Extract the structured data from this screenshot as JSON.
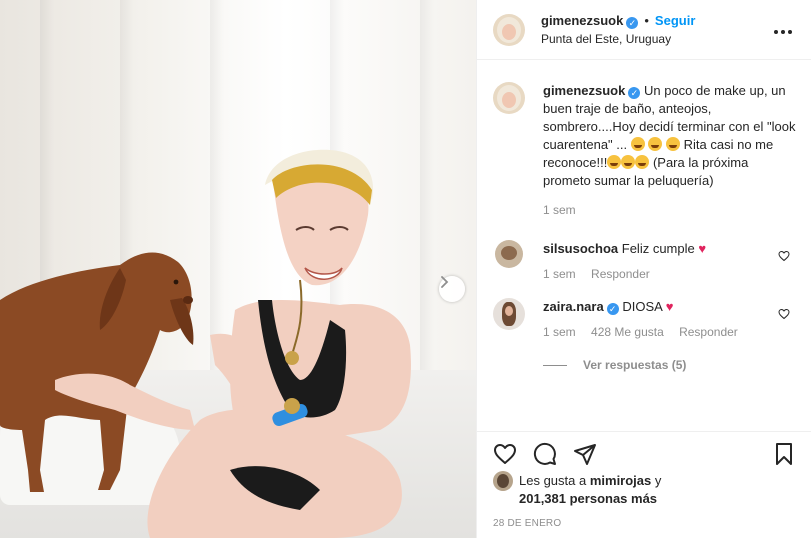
{
  "header": {
    "username": "gimenezsuok",
    "dot": "•",
    "follow_label": "Seguir",
    "location": "Punta del Este, Uruguay",
    "more_icon": "more-horizontal-icon"
  },
  "caption": {
    "username": "gimenezsuok",
    "text_part1": "Un poco de make up, un buen traje de baño, anteojos, sombrero....Hoy decidí terminar con el \"look cuarentena\" ...",
    "text_part2": "Rita casi no me reconoce!!!",
    "text_part3": "(Para la próxima prometo sumar la peluquería)",
    "time": "1 sem"
  },
  "comments": [
    {
      "username": "silsusochoa",
      "text": "Feliz cumple",
      "time": "1 sem",
      "reply_label": "Responder"
    },
    {
      "username": "zaira.nara",
      "text": "DIOSA",
      "time": "1 sem",
      "likes": "428 Me gusta",
      "reply_label": "Responder",
      "view_replies": "Ver respuestas (5)"
    }
  ],
  "actions": {
    "likes_prefix": "Les gusta a",
    "likes_user": "mimirojas",
    "likes_and": "y",
    "likes_others": "201,381 personas más",
    "date": "28 DE ENERO"
  },
  "colors": {
    "link_blue": "#0095f6",
    "verified_blue": "#3897f0",
    "heart_red": "#e0245e",
    "muted": "#8e8e8e"
  }
}
